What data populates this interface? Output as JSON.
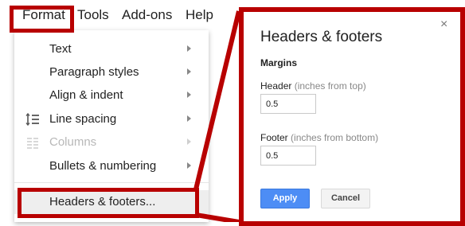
{
  "menubar": {
    "items": [
      {
        "label": "Format"
      },
      {
        "label": "Tools"
      },
      {
        "label": "Add-ons"
      },
      {
        "label": "Help"
      }
    ]
  },
  "format_menu": {
    "items": [
      {
        "label": "Text",
        "submenu": true,
        "disabled": false
      },
      {
        "label": "Paragraph styles",
        "submenu": true,
        "disabled": false
      },
      {
        "label": "Align & indent",
        "submenu": true,
        "disabled": false
      },
      {
        "label": "Line spacing",
        "submenu": true,
        "disabled": false,
        "icon": "line-spacing-icon"
      },
      {
        "label": "Columns",
        "submenu": true,
        "disabled": true,
        "icon": "columns-icon"
      },
      {
        "label": "Bullets & numbering",
        "submenu": true,
        "disabled": false
      },
      {
        "label": "Headers & footers...",
        "submenu": false,
        "disabled": false,
        "highlighted": true
      }
    ]
  },
  "dialog": {
    "title": "Headers & footers",
    "close_glyph": "×",
    "section": "Margins",
    "header_label": "Header",
    "header_hint": "(inches from top)",
    "header_value": "0.5",
    "footer_label": "Footer",
    "footer_hint": "(inches from bottom)",
    "footer_value": "0.5",
    "apply_label": "Apply",
    "cancel_label": "Cancel"
  },
  "colors": {
    "highlight": "#b80000",
    "primary_button": "#4d8df5"
  }
}
